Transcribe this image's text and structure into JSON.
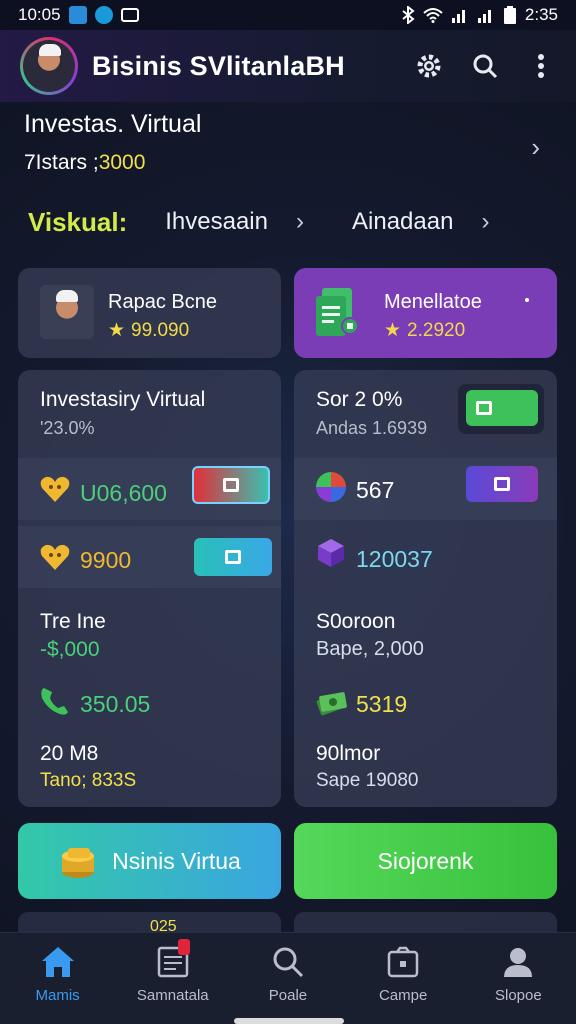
{
  "status_bar": {
    "time_left": "10:05",
    "time_right": "2:35"
  },
  "app_bar": {
    "title": "Bisinis SVlitanlaBH"
  },
  "section": {
    "title": "Investas. Virtual",
    "sub_label": "7Istars ;",
    "sub_value": "3000"
  },
  "nav_row": {
    "label": "Viskual:",
    "link1": "Ihvesaain",
    "link2": "Ainadaan"
  },
  "cards": {
    "left": {
      "title": "Rapac Bcne",
      "value": "99.090"
    },
    "right": {
      "title": "Menellatoe",
      "value": "2.2920"
    }
  },
  "panel_left": {
    "title": "Investasiry Virtual",
    "sub": "'23.0%",
    "row1_value": "U06,600",
    "row2_value": "9900",
    "trend_title": "Tre Ine",
    "trend_value": "-$,000",
    "row3_value": "350.05",
    "foot_title": "20 M8",
    "foot_value": "Tano; 833S"
  },
  "panel_right": {
    "title": "Sor 2 0%",
    "sub": "Andas 1.6939",
    "row1_value": "567",
    "row2_value": "120037",
    "mid_title": "S0oroon",
    "mid_value": "Bape, 2,000",
    "row3_value": "5319",
    "foot_title": "90lmor",
    "foot_value": "Sape 19080"
  },
  "buttons": {
    "left": "Nsinis Virtua",
    "right": "Siojorenk"
  },
  "peek": {
    "text": "025"
  },
  "bottom_nav": [
    {
      "label": "Mamis",
      "icon": "home-icon"
    },
    {
      "label": "Samnatala",
      "icon": "document-icon"
    },
    {
      "label": "Poale",
      "icon": "search-icon"
    },
    {
      "label": "Campe",
      "icon": "camera-icon"
    },
    {
      "label": "Slopoe",
      "icon": "person-icon"
    }
  ],
  "colors": {
    "accent": "#3a9af0",
    "highlight": "#f2e04a",
    "nav_label": "#d4ea4a",
    "purple_card": "#7b3db5"
  }
}
